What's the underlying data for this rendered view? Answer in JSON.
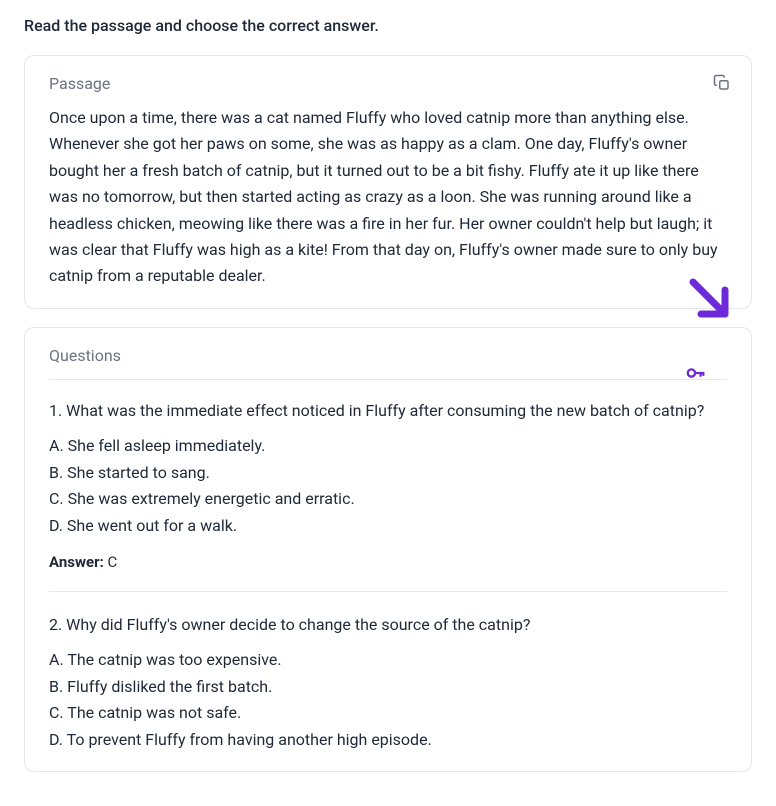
{
  "instruction": "Read the passage and choose the correct answer.",
  "passage": {
    "title": "Passage",
    "text": "Once upon a time, there was a cat named Fluffy who loved catnip more than anything else. Whenever she got her paws on some, she was as happy as a clam. One day, Fluffy's owner bought her a fresh batch of catnip, but it turned out to be a bit fishy. Fluffy ate it up like there was no tomorrow, but then started acting as crazy as a loon. She was running around like a headless chicken, meowing like there was a fire in her fur. Her owner couldn't help but laugh; it was clear that Fluffy was high as a kite! From that day on, Fluffy's owner made sure to only buy catnip from a reputable dealer."
  },
  "questions": {
    "title": "Questions",
    "answer_label": "Answer:",
    "items": [
      {
        "prompt": "1. What was the immediate effect noticed in Fluffy after consuming the new batch of catnip?",
        "options": {
          "a": "A. She fell asleep immediately.",
          "b": "B. She started to sang.",
          "c": "C. She was extremely energetic and erratic.",
          "d": "D. She went out for a walk."
        },
        "answer": "C"
      },
      {
        "prompt": "2. Why did Fluffy's owner decide to change the source of the catnip?",
        "options": {
          "a": "A. The catnip was too expensive.",
          "b": "B. Fluffy disliked the first batch.",
          "c": "C. The catnip was not safe.",
          "d": "D. To prevent Fluffy from having another high episode."
        },
        "answer": ""
      }
    ]
  }
}
